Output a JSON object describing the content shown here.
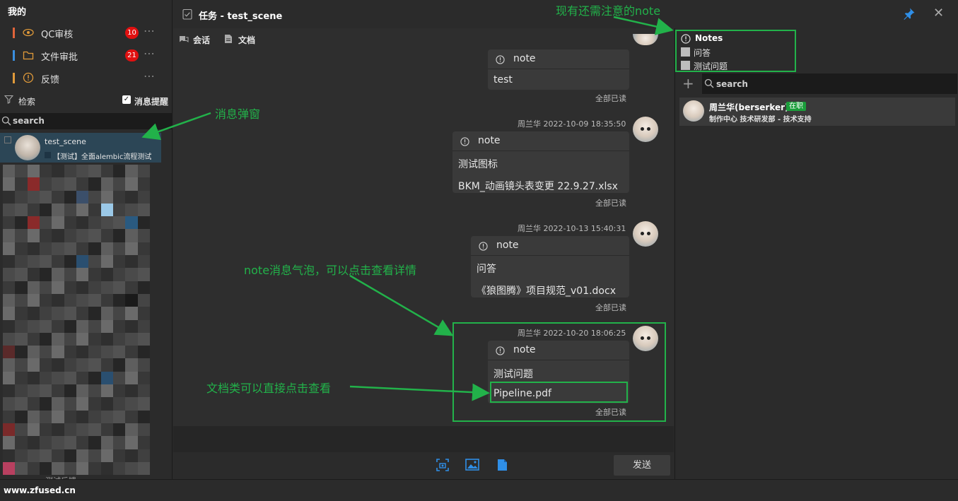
{
  "sidebar": {
    "title": "我的",
    "categories": [
      {
        "label": "QC审核",
        "badge": "10",
        "color": "#e0643a",
        "icon": "eye-icon"
      },
      {
        "label": "文件审批",
        "badge": "21",
        "color": "#3a8fe0",
        "icon": "folder-icon"
      },
      {
        "label": "反馈",
        "badge": "",
        "color": "#e09a3a",
        "icon": "alert-circle-icon"
      }
    ],
    "more": "⋯",
    "filter_label": "检索",
    "notify_label": "消息提醒",
    "notify_checked": "✓",
    "search_placeholder": "search",
    "conversation": {
      "name": "test_scene",
      "preview": "【测试】全面alembic流程测试"
    },
    "bottom_text": "测试反馈"
  },
  "topbar": {
    "title": "任务 - test_scene"
  },
  "chat": {
    "tabs": [
      "会话",
      "文档"
    ],
    "messages": [
      {
        "sender": "",
        "note_label": "note",
        "lines": [
          "test"
        ],
        "read": "全部已读"
      },
      {
        "sender": "周兰华 2022-10-09 18:35:50",
        "note_label": "note",
        "lines": [
          "测试图标",
          "BKM_动画镜头表变更 22.9.27.xlsx"
        ],
        "read": "全部已读"
      },
      {
        "sender": "周兰华 2022-10-13 15:40:31",
        "note_label": "note",
        "lines": [
          "问答",
          "《狼图腾》项目规范_v01.docx"
        ],
        "read": "全部已读"
      },
      {
        "sender": "周兰华 2022-10-20 18:06:25",
        "note_label": "note",
        "lines": [
          "测试问题",
          "Pipeline.pdf"
        ],
        "read": "全部已读"
      }
    ],
    "send_label": "发送"
  },
  "right": {
    "notes_title": "Notes",
    "notes_items": [
      "问答",
      "测试问题"
    ],
    "search_placeholder": "search",
    "member": {
      "name": "周兰华(berserker)",
      "status": "在职",
      "dept": "制作中心 技术研发部 - 技术支持"
    }
  },
  "annotations": {
    "top": "现有还需注意的note",
    "popup": "消息弹窗",
    "bubble": "note消息气泡，可以点击查看详情",
    "doc": "文档类可以直接点击查看"
  },
  "footer": {
    "url": "www.zfused.cn"
  },
  "colors": {
    "accent_green": "#22b24a",
    "badge_red": "#e01010",
    "pin_blue": "#2f8fe8"
  }
}
